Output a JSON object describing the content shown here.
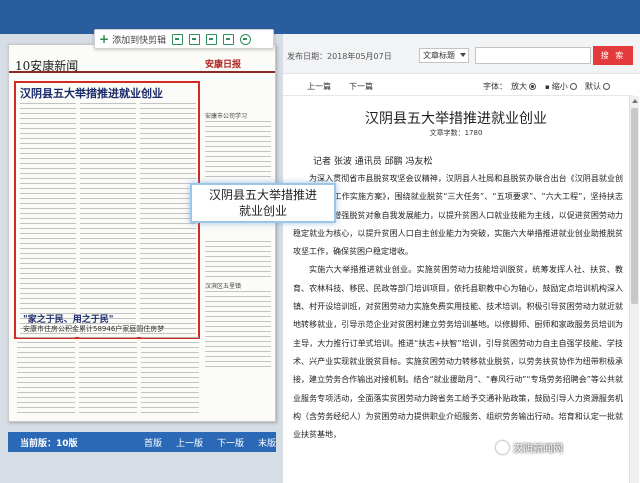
{
  "paper": {
    "page_tag": "10安康新闻",
    "logo_text": "安康日报",
    "toolbar_add": "添加到快剪辑",
    "frame_headline": "汉阴县五大举措推进就业创业",
    "callout_line1": "汉阴县五大举措推进",
    "callout_line2": "就业创业",
    "sub_headline": "\"家之于民、用之于民\"",
    "sub_headline2": "安康市住房公积金累计58946户家庭圆住房梦",
    "side_note": "安康市公司学习",
    "side_note2": "汉滨区五里镇"
  },
  "pager": {
    "current_label": "当前版：10版",
    "first": "首版",
    "prev": "上一版",
    "next": "下一版",
    "last": "末版"
  },
  "reader": {
    "pubdate": "发布日期：2018年05月07日",
    "select_value": "文章标题",
    "search_btn": "搜 索",
    "prev_article": "上一篇",
    "next_article": "下一篇",
    "font_label": "字体：",
    "font_large": "放大",
    "font_small": "缩小",
    "font_default": "默认",
    "title": "汉阴县五大举措推进就业创业",
    "word_count": "文章字数：1780",
    "byline": "记者 张波 通讯员 邱鹏 冯友松",
    "paragraphs": [
      "为深入贯彻省市县脱贫攻坚会议精神，汉阴县人社局和县脱贫办联合出台《汉阴县就业创业脱贫攻坚工作实施方案》，围绕就业脱贫“三大任务”、“五项要求”、“六大工程”，坚持扶志扶智并重，增强脱贫对象自我发展能力，以提升贫困人口就业技能为主线，以促进贫困劳动力稳定就业为核心，以提升贫困人口自主创业能力为突破，实施六大举措推进就业创业助推脱贫攻坚工作，确保贫困户稳定增收。",
      "实施六大举措推进就业创业。实施贫困劳动力技能培训脱贫，统筹发挥人社、扶贫、教育、农林科技、移民、民政等部门培训项目，依托县职教中心为轴心，鼓励定点培训机构深入镇、村开设培训班，对贫困劳动力实施免费实用技能、技术培训。积极引导贫困劳动力就近就地转移就业，引导示范企业对贫困村建立劳务培训基地。以修脚师、厨师和家政服务员培训为主导，大力推行订单式培训。推进“扶志+扶智”培训，引导贫困劳动力自主自强学技能、学技术、兴产业实现就业脱贫目标。实施贫困劳动力转移就业脱贫，以劳务扶贫协作为纽带积极承接，建立劳务合作输出对接机制。结合“就业援助月”、“春风行动”“专场劳务招聘会”等公共就业服务专项活动，全面落实贫困劳动力跨省务工给予交通补贴政策，鼓励引导人力资源服务机构（含劳务经纪人）为贫困劳动力提供职业介绍服务、组织劳务输出行动。培育和认定一批就业扶贫基地，"
    ]
  },
  "watermark": "汉阴新闻网"
}
